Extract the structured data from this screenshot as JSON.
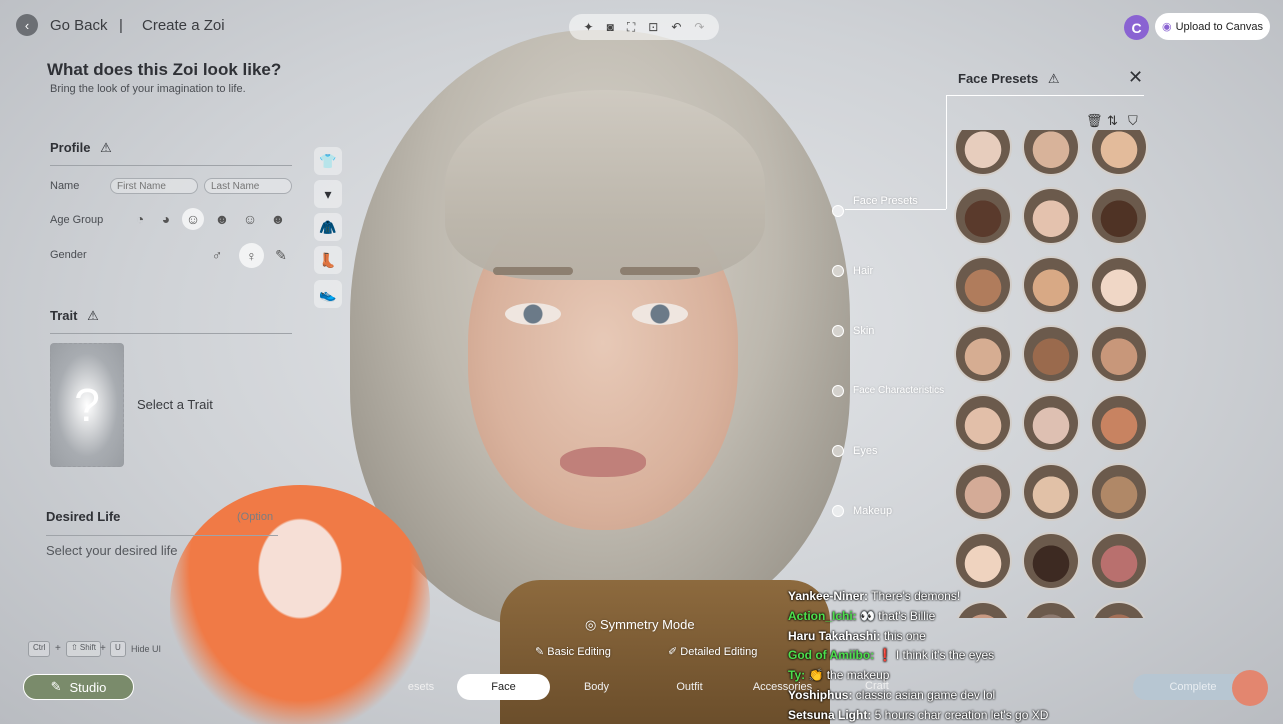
{
  "topbar": {
    "back_label": "Go Back",
    "separator": "|",
    "page_title": "Create a Zoi",
    "upload_label": "Upload to Canvas",
    "logo_letter": "C"
  },
  "toolbar": {
    "icons": [
      "sparkle-icon",
      "camera-icon",
      "frame-icon",
      "focus-icon",
      "undo-icon",
      "redo-icon"
    ]
  },
  "left_panel": {
    "heading": "What does this Zoi look like?",
    "subheading": "Bring the look of your imagination to life.",
    "profile": {
      "title": "Profile",
      "name_label": "Name",
      "first_name_placeholder": "First Name",
      "last_name_placeholder": "Last Name",
      "age_label": "Age Group",
      "gender_label": "Gender"
    },
    "trait": {
      "title": "Trait",
      "card_symbol": "?",
      "select_label": "Select a Trait"
    },
    "desired_life": {
      "title": "Desired Life",
      "optional": "(Option",
      "placeholder": "Select your desired life"
    }
  },
  "right_panel": {
    "title": "Face Presets",
    "nav": [
      "Face Presets",
      "Hair",
      "Skin",
      "Face Characteristics",
      "Eyes",
      "Makeup"
    ],
    "preset_colors": [
      "#e7cdbd",
      "#d8b39a",
      "#e3bb9b",
      "#5a3a2c",
      "#e4c2ae",
      "#4f3325",
      "#b07c5c",
      "#d8a985",
      "#f0d7c6",
      "#d6ad92",
      "#9a6a4d",
      "#c8977a",
      "#e2bfa9",
      "#dec0b2",
      "#c88361",
      "#d4ab97",
      "#e1c1a7",
      "#b08867",
      "#efd3bf",
      "#3d2a22",
      "#b9706e",
      "#c89a83",
      "#8d7a70",
      "#a47058"
    ]
  },
  "bottom": {
    "symmetry_label": "Symmetry Mode",
    "basic_editing": "Basic Editing",
    "detailed_editing": "Detailed Editing",
    "tabs": [
      "esets",
      "Face",
      "Body",
      "Outfit",
      "Accessories"
    ],
    "active_tab": "Face",
    "studio_label": "Studio",
    "hide_ui_label": "Hide UI",
    "keys": [
      "Ctrl",
      "⇧ Shift",
      "U"
    ],
    "complete_label": "Complete",
    "craft_label": "Craft"
  },
  "chat": [
    {
      "user": "Yankee-Niner:",
      "color": "#ffffff",
      "message": "There's demons!"
    },
    {
      "user": "Action_Ichi:",
      "color": "#4de04d",
      "message": "👀 that's Billie"
    },
    {
      "user": "Haru Takahashi:",
      "color": "#ffffff",
      "message": "this one"
    },
    {
      "user": "God of Amiibo:",
      "color": "#4de04d",
      "message": "❗ I think it's the eyes"
    },
    {
      "user": "Ty:",
      "color": "#4de04d",
      "message": "👏 the makeup"
    },
    {
      "user": "Yoshiphus:",
      "color": "#ffffff",
      "message": "classic asian game dev lol"
    },
    {
      "user": "Setsuna Light:",
      "color": "#ffffff",
      "message": "5 hours char creation let's go XD"
    }
  ]
}
